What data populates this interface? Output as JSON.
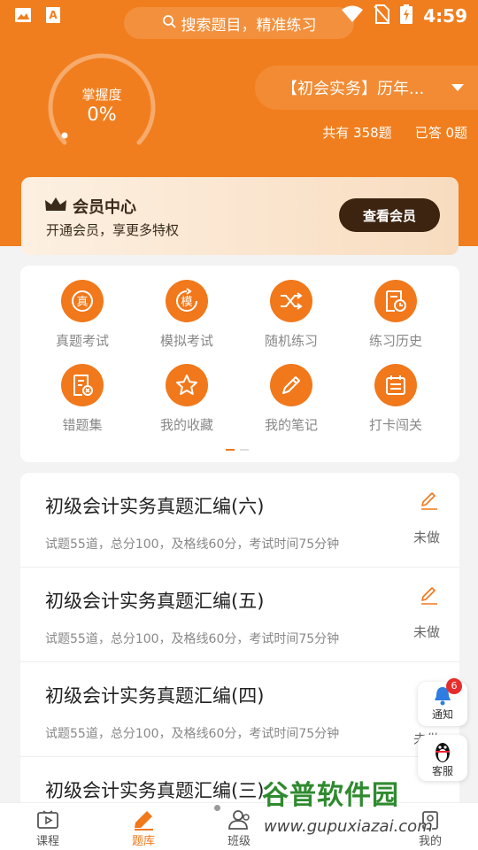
{
  "status_bar": {
    "time": "4:59",
    "icons": [
      "image-icon",
      "app-a-icon",
      "wifi-icon",
      "no-sim-icon",
      "battery-charging-icon"
    ]
  },
  "search": {
    "placeholder": "搜索题目，精准练习"
  },
  "progress": {
    "label": "掌握度",
    "value": "0%",
    "fraction": 0
  },
  "subject": {
    "selected": "【初会实务】历年..."
  },
  "stats": {
    "total": "共有 358题",
    "answered": "已答 0题"
  },
  "member": {
    "title": "会员中心",
    "subtitle": "开通会员，享更多特权",
    "button": "查看会员"
  },
  "features": [
    {
      "label": "真题考试",
      "icon": "real-exam-icon",
      "glyph": "真"
    },
    {
      "label": "模拟考试",
      "icon": "mock-exam-icon",
      "glyph": "模"
    },
    {
      "label": "随机练习",
      "icon": "shuffle-icon"
    },
    {
      "label": "练习历史",
      "icon": "history-icon"
    },
    {
      "label": "错题集",
      "icon": "wrong-questions-icon"
    },
    {
      "label": "我的收藏",
      "icon": "star-icon"
    },
    {
      "label": "我的笔记",
      "icon": "pencil-icon"
    },
    {
      "label": "打卡闯关",
      "icon": "calendar-icon"
    }
  ],
  "papers": [
    {
      "title": "初级会计实务真题汇编(六)",
      "meta": "试题55道，总分100，及格线60分，考试时间75分钟",
      "status": "未做"
    },
    {
      "title": "初级会计实务真题汇编(五)",
      "meta": "试题55道，总分100，及格线60分，考试时间75分钟",
      "status": "未做"
    },
    {
      "title": "初级会计实务真题汇编(四)",
      "meta": "试题55道，总分100，及格线60分，考试时间75分钟",
      "status": "未做"
    },
    {
      "title": "初级会计实务真题汇编(三)",
      "meta": "",
      "status": ""
    }
  ],
  "floating": {
    "notify_label": "通知",
    "notify_badge": "6",
    "service_label": "客服"
  },
  "nav": [
    {
      "label": "课程",
      "icon": "video-icon"
    },
    {
      "label": "题库",
      "icon": "edit-icon"
    },
    {
      "label": "班级",
      "icon": "class-icon"
    },
    {
      "label": "",
      "icon": ""
    },
    {
      "label": "我的",
      "icon": "profile-icon"
    }
  ],
  "watermark": {
    "text": "谷普软件园",
    "url": "www.gupuxiazai.com"
  },
  "colors": {
    "brand": "#f17e1e",
    "accent": "#f1781b",
    "member_btn": "#3d2410"
  }
}
